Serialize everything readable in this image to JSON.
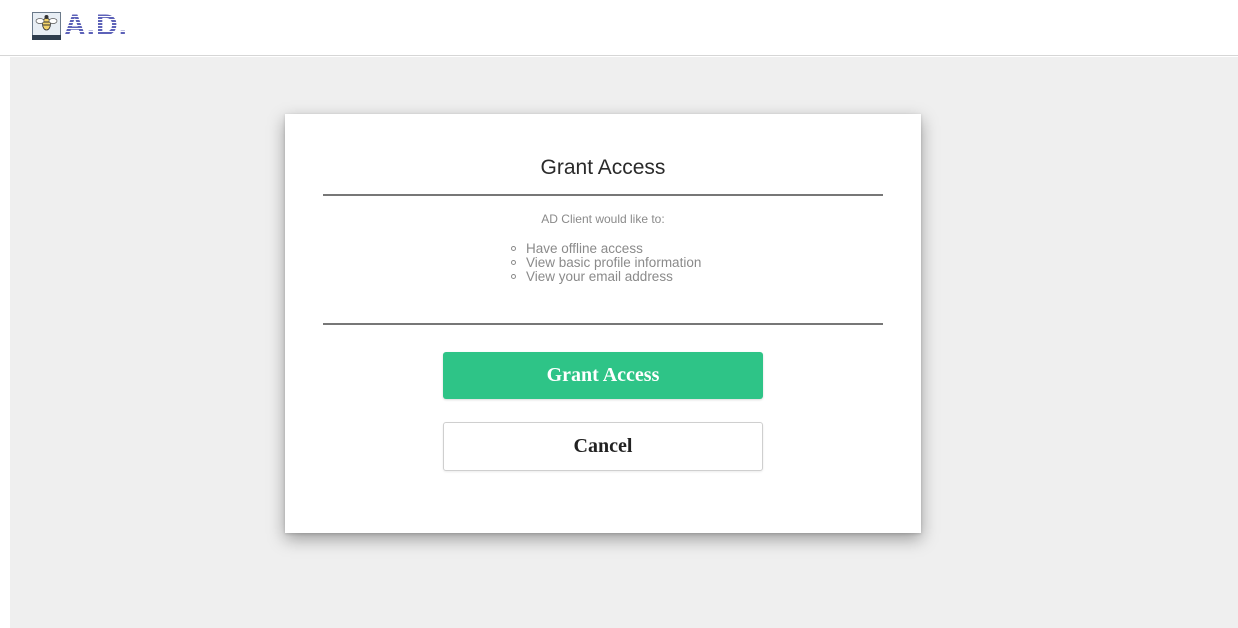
{
  "header": {
    "logo_text": "A.D.",
    "logo_icon": "bee-icon"
  },
  "dialog": {
    "title": "Grant Access",
    "subtitle": "AD Client would like to:",
    "permissions": [
      "Have offline access",
      "View basic profile information",
      "View your email address"
    ],
    "grant_label": "Grant Access",
    "cancel_label": "Cancel"
  },
  "colors": {
    "accent": "#2ec487",
    "logo": "#5d62b8",
    "background": "#efefef"
  }
}
